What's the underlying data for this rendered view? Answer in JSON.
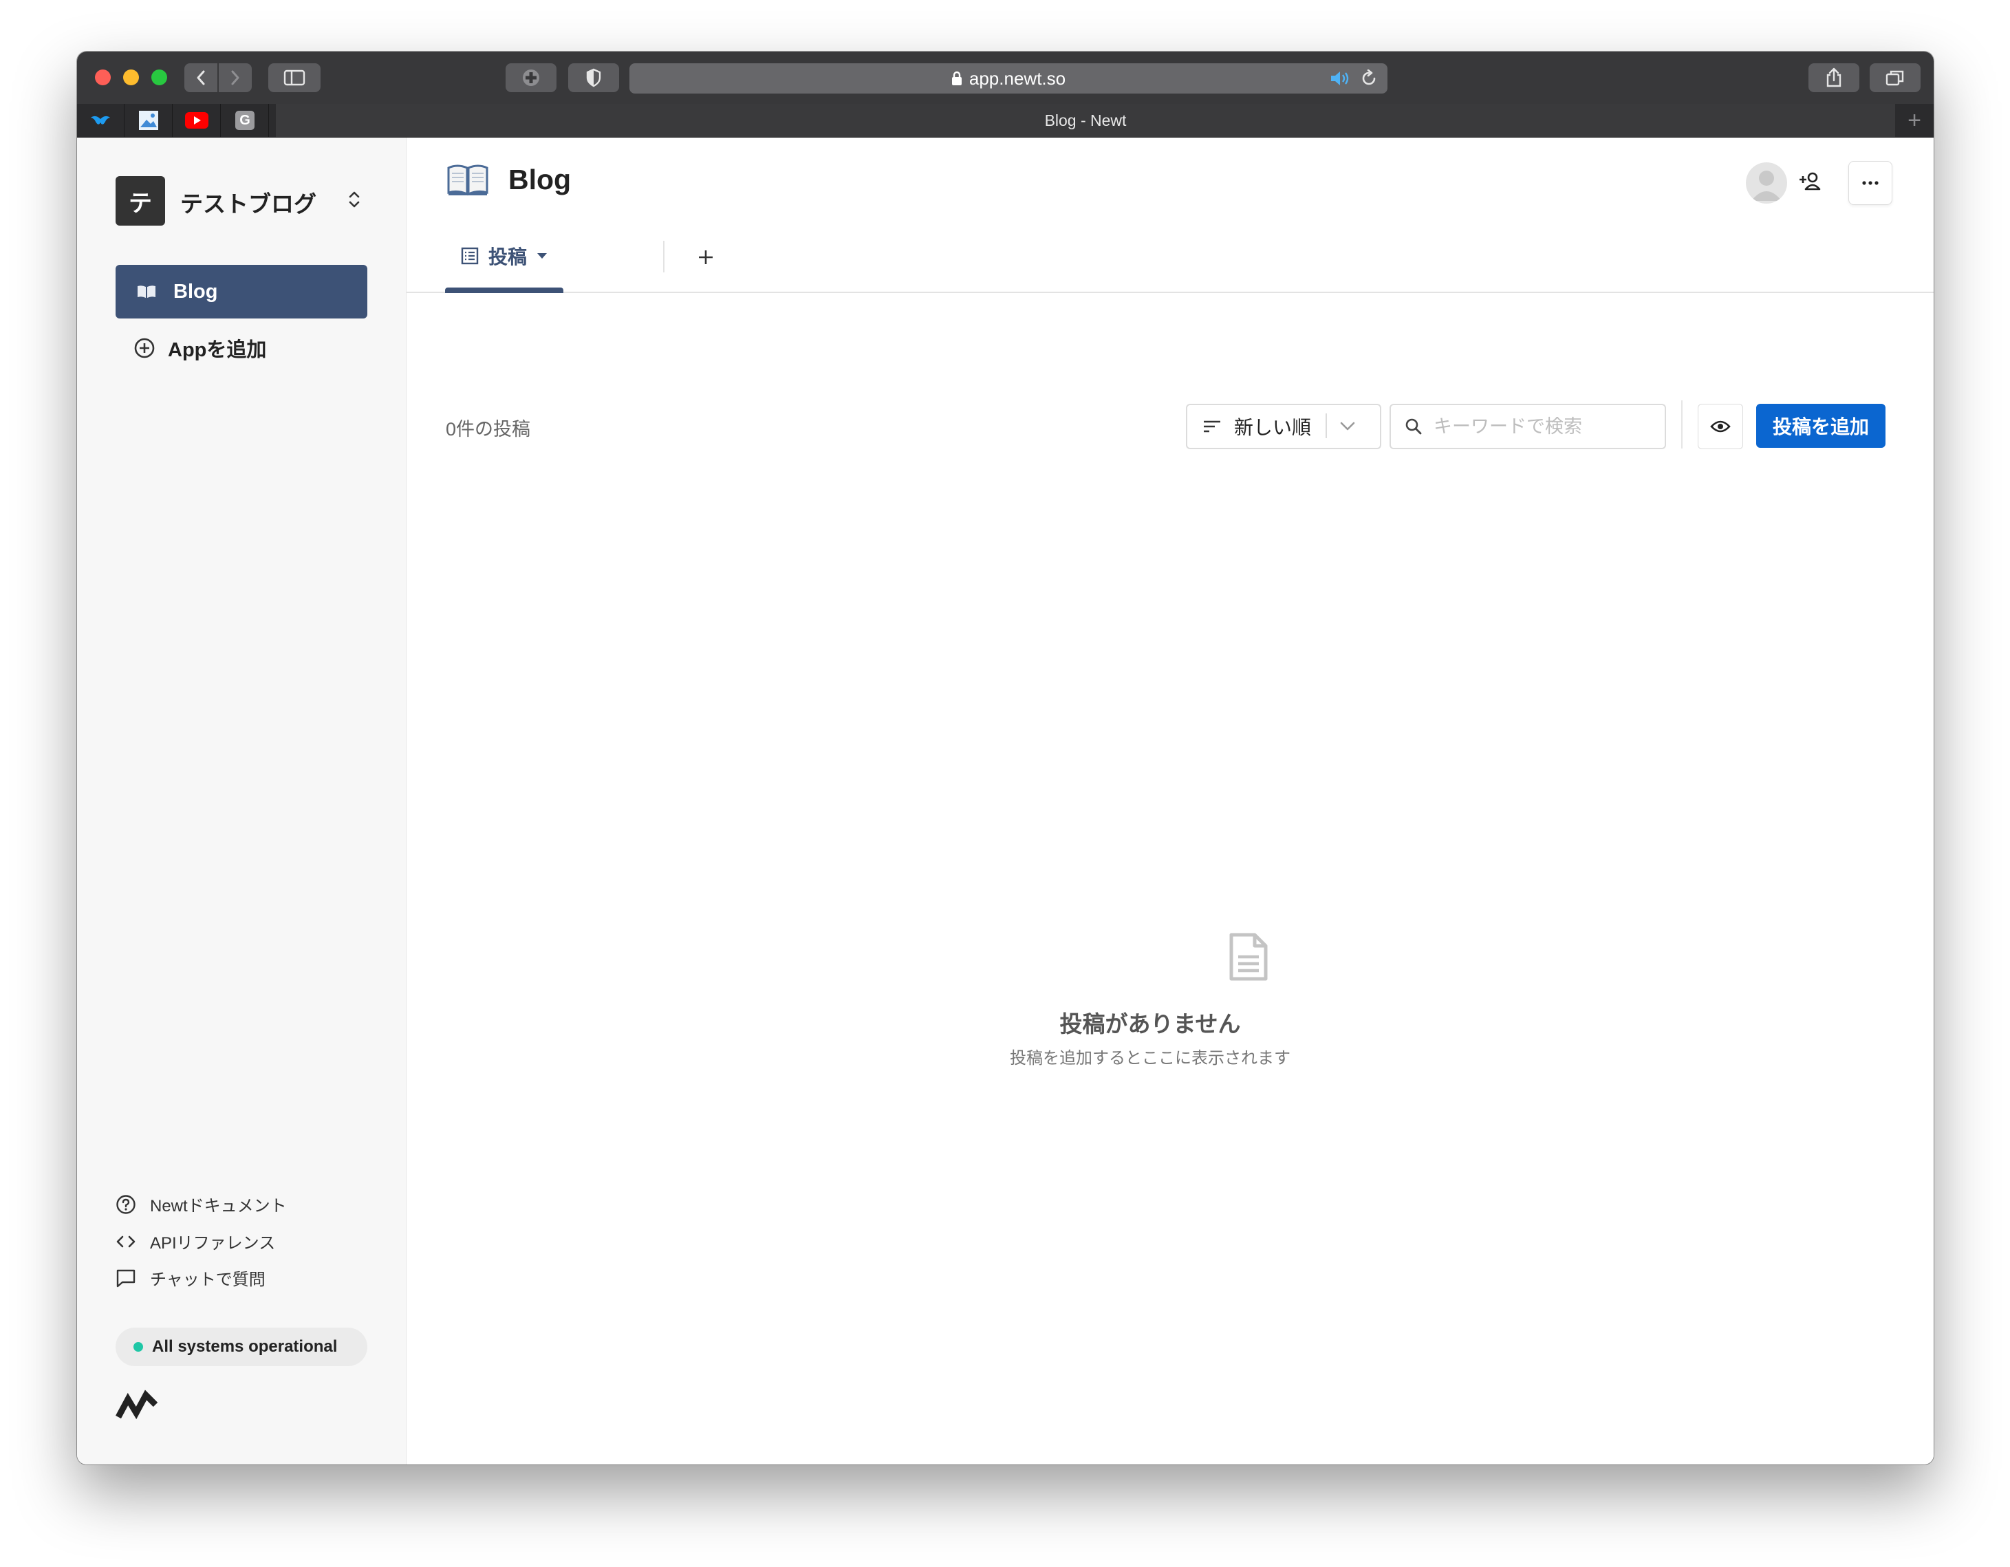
{
  "browser": {
    "url": "app.newt.so",
    "tab_title": "Blog - Newt",
    "pinned_tabs": [
      "tweetdeck-icon",
      "image-icon",
      "youtube-icon",
      "google-icon"
    ],
    "pinned_google_letter": "G"
  },
  "sidebar": {
    "workspace_initial": "テ",
    "workspace_name": "テストブログ",
    "apps": [
      {
        "label": "Blog",
        "icon": "book-icon",
        "active": true
      }
    ],
    "add_app_label": "Appを追加",
    "help_links": [
      {
        "label": "Newtドキュメント",
        "icon": "question-circle-icon"
      },
      {
        "label": "APIリファレンス",
        "icon": "code-icon"
      },
      {
        "label": "チャットで質問",
        "icon": "chat-icon"
      }
    ],
    "status": {
      "label": "All systems operational",
      "color": "#1fc7a6"
    }
  },
  "main": {
    "title": "Blog",
    "title_icon": "open-book-icon",
    "tabs": [
      {
        "label": "投稿",
        "active": true
      }
    ],
    "post_count_label": "0件の投稿",
    "sort_label": "新しい順",
    "search_placeholder": "キーワードで検索",
    "add_post_label": "投稿を追加",
    "empty_title": "投稿がありません",
    "empty_subtitle": "投稿を追加するとここに表示されます"
  },
  "colors": {
    "accent": "#3d5276",
    "primary_button": "#0b66d0",
    "status_green": "#1fc7a6"
  }
}
